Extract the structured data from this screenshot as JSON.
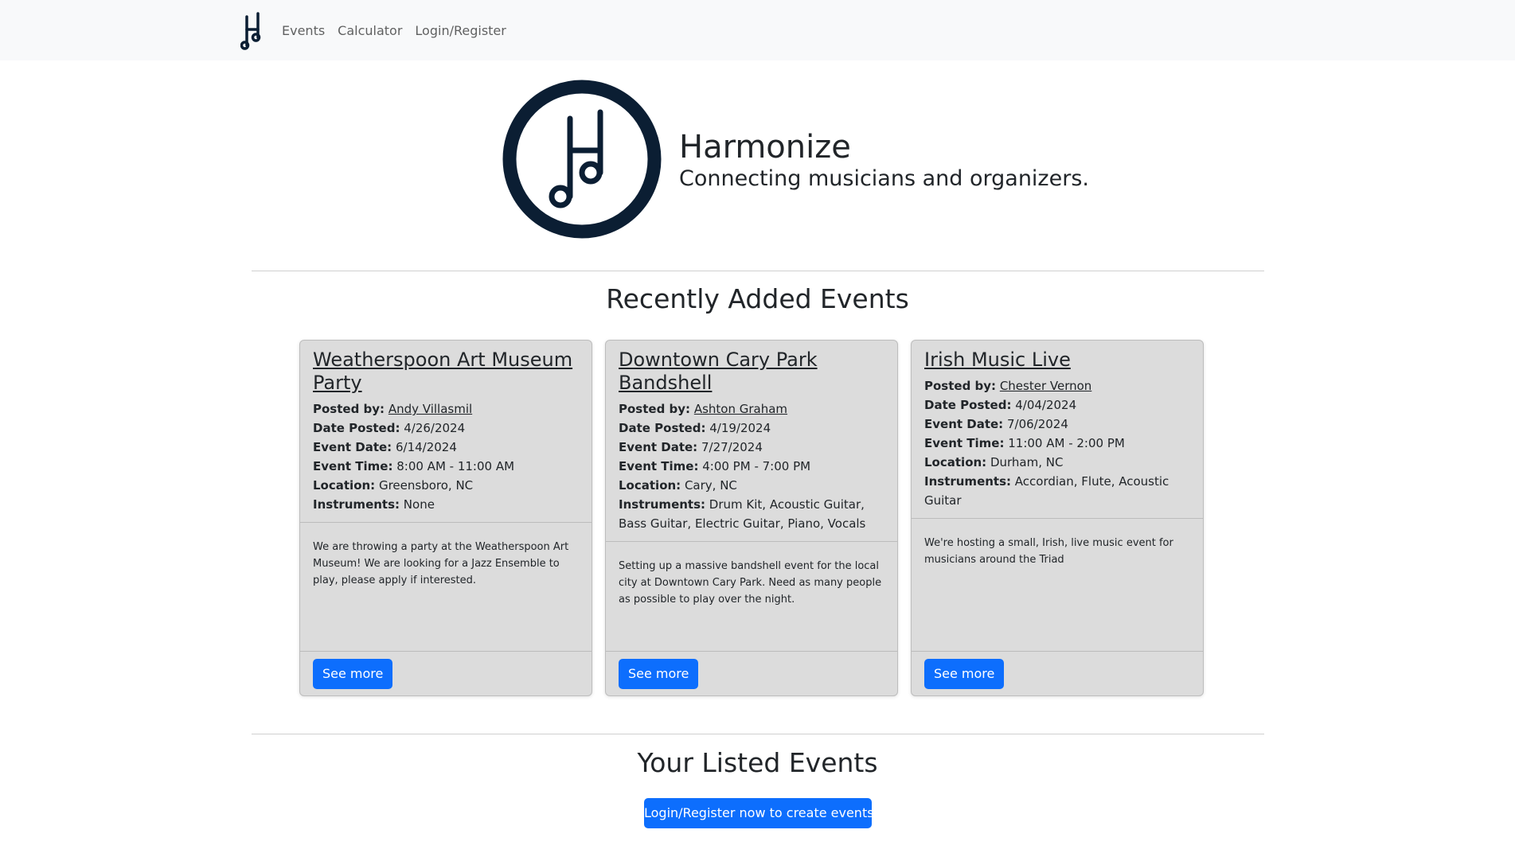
{
  "nav": {
    "links": [
      "Events",
      "Calculator",
      "Login/Register"
    ]
  },
  "hero": {
    "title": "Harmonize",
    "subtitle": "Connecting musicians and organizers."
  },
  "recent": {
    "heading": "Recently Added Events",
    "labels": {
      "posted_by": "Posted by:",
      "date_posted": "Date Posted:",
      "event_date": "Event Date:",
      "event_time": "Event Time:",
      "location": "Location:",
      "instruments": "Instruments:"
    },
    "button_label": "See more",
    "events": [
      {
        "title": "Weatherspoon Art Museum Party",
        "posted_by": "Andy Villasmil",
        "date_posted": "4/26/2024",
        "event_date": "6/14/2024",
        "event_time": "8:00 AM - 11:00 AM",
        "location": "Greensboro, NC",
        "instruments": "None",
        "description": "We are throwing a party at the Weatherspoon Art Museum! We are looking for a Jazz Ensemble to play, please apply if interested."
      },
      {
        "title": "Downtown Cary Park Bandshell",
        "posted_by": "Ashton Graham",
        "date_posted": "4/19/2024",
        "event_date": "7/27/2024",
        "event_time": "4:00 PM - 7:00 PM",
        "location": "Cary, NC",
        "instruments": "Drum Kit, Acoustic Guitar, Bass Guitar, Electric Guitar, Piano, Vocals",
        "description": "Setting up a massive bandshell event for the local city at Downtown Cary Park. Need as many people as possible to play over the night."
      },
      {
        "title": "Irish Music Live",
        "posted_by": "Chester Vernon",
        "date_posted": "4/04/2024",
        "event_date": "7/06/2024",
        "event_time": "11:00 AM - 2:00 PM",
        "location": "Durham, NC",
        "instruments": "Accordian, Flute, Acoustic Guitar",
        "description": "We're hosting a small, Irish, live music event for musicians around the Triad"
      }
    ]
  },
  "listed": {
    "heading": "Your Listed Events",
    "cta_label": "Login/Register now to create events!"
  },
  "colors": {
    "primary": "#0d6efd",
    "logo": "#0b1e33",
    "card_bg": "#dcdcdc",
    "navbar_bg": "#f8f9fa"
  },
  "icons": {
    "brand": "harmonize-note-logo-icon"
  }
}
